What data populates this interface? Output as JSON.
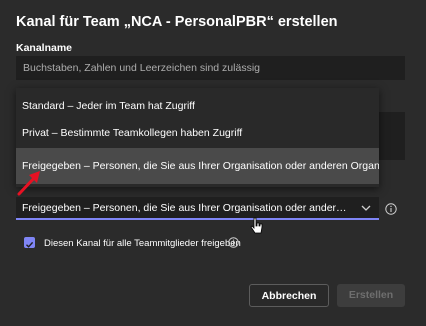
{
  "dialog": {
    "title": "Kanal für Team „NCA - PersonalPBR“ erstellen",
    "channel_name_label": "Kanalname",
    "channel_name_placeholder": "Buchstaben, Zahlen und Leerzeichen sind zulässig"
  },
  "privacy_menu": {
    "options": [
      {
        "label": "Standard – Jeder im Team hat Zugriff",
        "selected": false
      },
      {
        "label": "Privat – Bestimmte Teamkollegen haben Zugriff",
        "selected": false
      },
      {
        "label": "Freigegeben – Personen, die Sie aus Ihrer Organisation oder anderen Organisati",
        "selected": true
      }
    ]
  },
  "privacy_select": {
    "value": "Freigegeben – Personen, die Sie aus Ihrer Organisation oder anderen Or..."
  },
  "share_checkbox": {
    "label": "Diesen Kanal für alle Teammitglieder freigeben",
    "checked": true
  },
  "buttons": {
    "cancel": "Abbrechen",
    "create": "Erstellen"
  },
  "colors": {
    "accent": "#7f85f5",
    "arrow": "#e81123"
  },
  "icons": [
    "chevron-down-icon",
    "info-icon",
    "check-icon",
    "red-arrow-annotation",
    "mouse-pointer-icon"
  ]
}
